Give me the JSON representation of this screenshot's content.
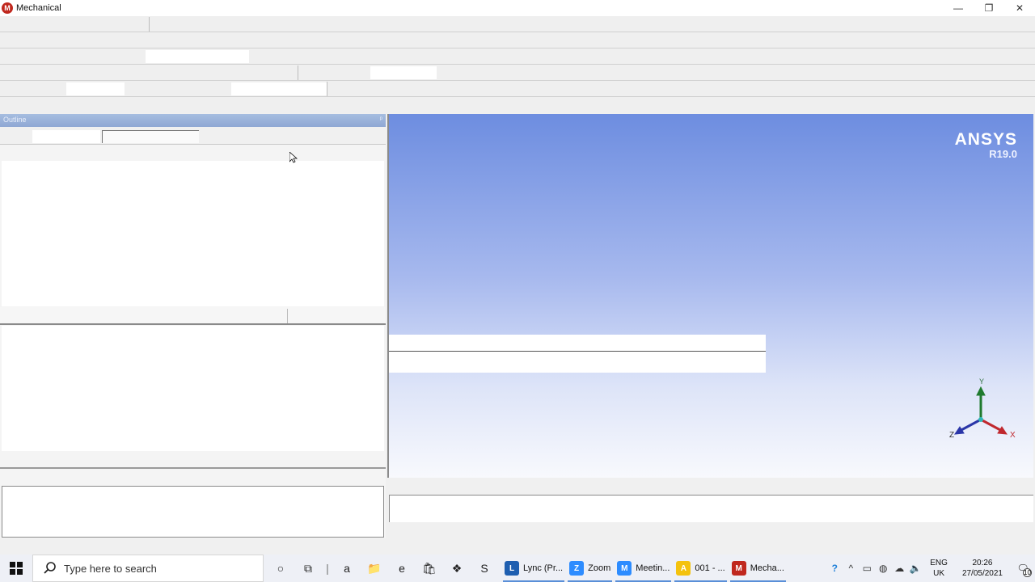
{
  "window": {
    "title": "Mechanical",
    "icon_letter": "M",
    "controls": {
      "minimize": "—",
      "restore": "❐",
      "close": "✕"
    }
  },
  "outline": {
    "title": "Outline",
    "pin_glyph": "ᵖ"
  },
  "viewport": {
    "brand": "ANSYS",
    "version": "R19.0",
    "axes": {
      "x": "X",
      "y": "Y",
      "z": "Z"
    },
    "colors": {
      "x": "#c0282e",
      "y": "#1f7a2e",
      "z": "#2a36a8"
    }
  },
  "taskbar": {
    "search_placeholder": "Type here to search",
    "pinned": [
      {
        "name": "cortana",
        "glyph": "○"
      },
      {
        "name": "task-view",
        "glyph": "⧉"
      },
      {
        "name": "separator",
        "glyph": "|"
      },
      {
        "name": "amazon",
        "glyph": "a"
      },
      {
        "name": "file-explorer",
        "glyph": "📁"
      },
      {
        "name": "edge",
        "glyph": "e"
      },
      {
        "name": "store",
        "glyph": "🛍"
      },
      {
        "name": "dropbox",
        "glyph": "❖"
      },
      {
        "name": "skype-app",
        "glyph": "S"
      }
    ],
    "apps": [
      {
        "label": "Lync (Pr...",
        "color": "#1f5fb0",
        "glyph": "L"
      },
      {
        "label": "Zoom",
        "color": "#2d8cff",
        "glyph": "Z"
      },
      {
        "label": "Meetin...",
        "color": "#2d8cff",
        "glyph": "M"
      },
      {
        "label": "001 - ...",
        "color": "#f4c20d",
        "glyph": "A"
      },
      {
        "label": "Mecha...",
        "color": "#c0281e",
        "glyph": "M"
      }
    ],
    "tray": {
      "help": "?",
      "chevron": "^",
      "lang_line1": "ENG",
      "lang_line2": "UK",
      "time": "20:26",
      "date": "27/05/2021",
      "notification_count": "10"
    }
  }
}
